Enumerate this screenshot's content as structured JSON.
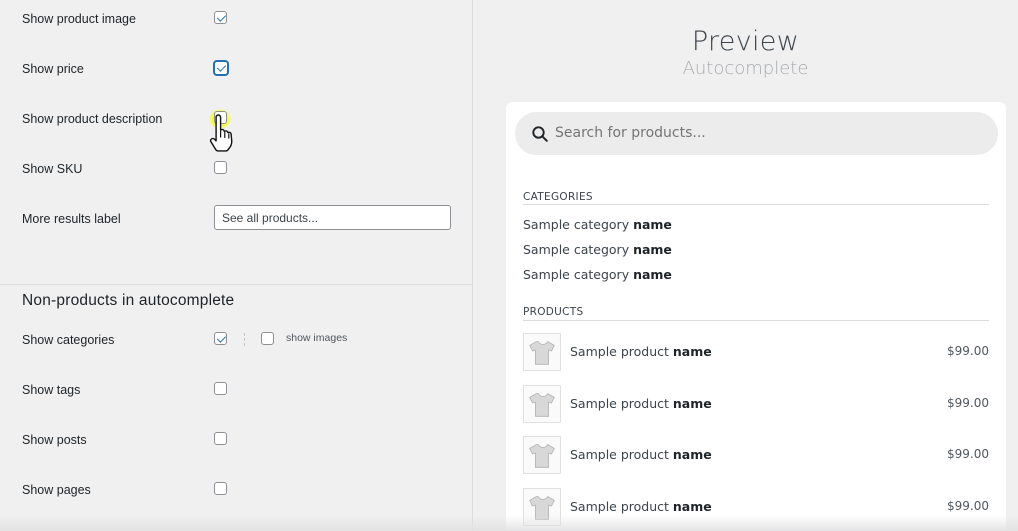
{
  "settings": {
    "display_rows": [
      {
        "label": "Show product image",
        "checked": true
      },
      {
        "label": "Show price",
        "checked": true
      },
      {
        "label": "Show product description",
        "checked": false
      },
      {
        "label": "Show SKU",
        "checked": false
      }
    ],
    "more_results": {
      "label": "More results label",
      "value": "See all products..."
    },
    "non_products_title": "Non-products in autocomplete",
    "non_product_rows": [
      {
        "label": "Show categories",
        "checked": true
      },
      {
        "label": "Show tags",
        "checked": false
      },
      {
        "label": "Show posts",
        "checked": false
      },
      {
        "label": "Show pages",
        "checked": false
      }
    ],
    "show_images_label": "show images",
    "show_images_checked": false
  },
  "preview": {
    "title": "Preview",
    "subtitle": "Autocomplete",
    "search_placeholder": "Search for products...",
    "categories_title": "CATEGORIES",
    "categories": [
      {
        "prefix": "Sample category",
        "bold": "name"
      },
      {
        "prefix": "Sample category",
        "bold": "name"
      },
      {
        "prefix": "Sample category",
        "bold": "name"
      }
    ],
    "products_title": "PRODUCTS",
    "products": [
      {
        "prefix": "Sample product",
        "bold": "name",
        "price": "$99.00"
      },
      {
        "prefix": "Sample product",
        "bold": "name",
        "price": "$99.00"
      },
      {
        "prefix": "Sample product",
        "bold": "name",
        "price": "$99.00"
      },
      {
        "prefix": "Sample product",
        "bold": "name",
        "price": "$99.00"
      }
    ]
  },
  "colors": {
    "accent": "#2271b1",
    "highlight": "#f6ff00",
    "background": "#f0f0f1"
  }
}
